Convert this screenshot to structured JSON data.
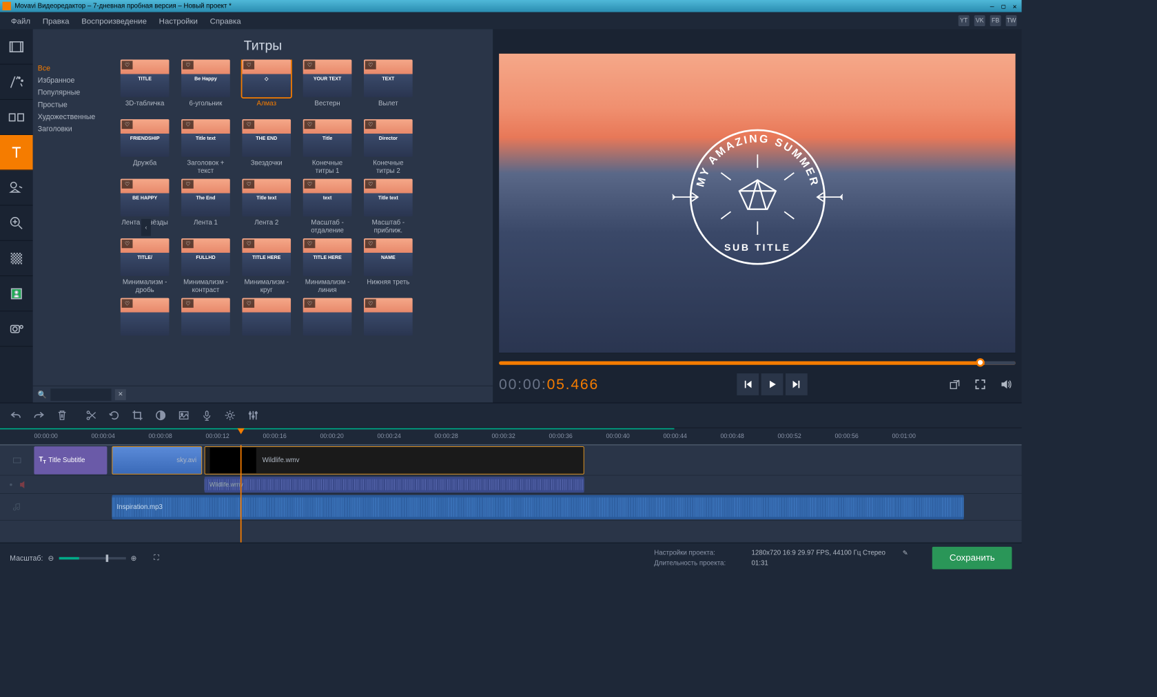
{
  "window": {
    "title": "Movavi Видеоредактор – 7-дневная пробная версия – Новый проект *"
  },
  "menu": {
    "items": [
      "Файл",
      "Правка",
      "Воспроизведение",
      "Настройки",
      "Справка"
    ],
    "social": [
      "YT",
      "VK",
      "FB",
      "TW"
    ]
  },
  "sidebar": {
    "tools": [
      {
        "name": "media-icon"
      },
      {
        "name": "filters-icon"
      },
      {
        "name": "transitions-icon"
      },
      {
        "name": "titles-icon",
        "active": true
      },
      {
        "name": "stickers-icon"
      },
      {
        "name": "zoom-icon"
      },
      {
        "name": "highlight-icon"
      },
      {
        "name": "chroma-icon"
      },
      {
        "name": "record-icon"
      }
    ]
  },
  "titles": {
    "heading": "Титры",
    "categories": [
      "Все",
      "Избранное",
      "Популярные",
      "Простые",
      "Художественные",
      "Заголовки"
    ],
    "active_category": 0,
    "grid": [
      [
        {
          "label": "3D-табличка",
          "thumb": "TITLE"
        },
        {
          "label": "6-угольник",
          "thumb": "Be Happy"
        },
        {
          "label": "Алмаз",
          "thumb": "◇",
          "selected": true
        },
        {
          "label": "Вестерн",
          "thumb": "YOUR TEXT"
        },
        {
          "label": "Вылет",
          "thumb": "TEXT"
        }
      ],
      [
        {
          "label": "Дружба",
          "thumb": "FRIENDSHIP"
        },
        {
          "label": "Заголовок + текст",
          "thumb": "Title text"
        },
        {
          "label": "Звездочки",
          "thumb": "THE END"
        },
        {
          "label": "Конечные титры 1",
          "thumb": "Title"
        },
        {
          "label": "Конечные титры 2",
          "thumb": "Director"
        }
      ],
      [
        {
          "label": "Лента - звёзды",
          "thumb": "BE HAPPY"
        },
        {
          "label": "Лента 1",
          "thumb": "The End"
        },
        {
          "label": "Лента 2",
          "thumb": "Title text"
        },
        {
          "label": "Масштаб - отдаление",
          "thumb": "text"
        },
        {
          "label": "Масштаб - приближ.",
          "thumb": "Title text"
        }
      ],
      [
        {
          "label": "Минимализм - дробь",
          "thumb": "TITLE/"
        },
        {
          "label": "Минимализм - контраст",
          "thumb": "FULLHD"
        },
        {
          "label": "Минимализм - круг",
          "thumb": "TITLE HERE"
        },
        {
          "label": "Минимализм - линия",
          "thumb": "TITLE HERE"
        },
        {
          "label": "Нижняя треть",
          "thumb": "NAME"
        }
      ],
      [
        {
          "label": "",
          "thumb": ""
        },
        {
          "label": "",
          "thumb": ""
        },
        {
          "label": "",
          "thumb": ""
        },
        {
          "label": "",
          "thumb": ""
        },
        {
          "label": "",
          "thumb": ""
        }
      ]
    ],
    "search_placeholder": ""
  },
  "preview": {
    "overlay_top": "MY AMAZING SUMMER",
    "overlay_bottom": "SUB TITLE",
    "timecode_gray": "00:00:",
    "timecode_orange": "05.466"
  },
  "timeline": {
    "ticks": [
      "00:00:00",
      "00:00:04",
      "00:00:08",
      "00:00:12",
      "00:00:16",
      "00:00:20",
      "00:00:24",
      "00:00:28",
      "00:00:32",
      "00:00:36",
      "00:00:40",
      "00:00:44",
      "00:00:48",
      "00:00:52",
      "00:00:56",
      "00:01:00"
    ],
    "title_clip": "Title Subtitle",
    "video1": "sky.avi",
    "video2": "Wildlife.wmv",
    "audio2": "Wildlife.wmv",
    "audio1": "Inspiration.mp3"
  },
  "status": {
    "zoom_label": "Масштаб:",
    "project_settings_label": "Настройки проекта:",
    "project_settings_value": "1280x720 16:9 29.97 FPS, 44100 Гц Стерео",
    "duration_label": "Длительность проекта:",
    "duration_value": "01:31",
    "save": "Сохранить"
  }
}
